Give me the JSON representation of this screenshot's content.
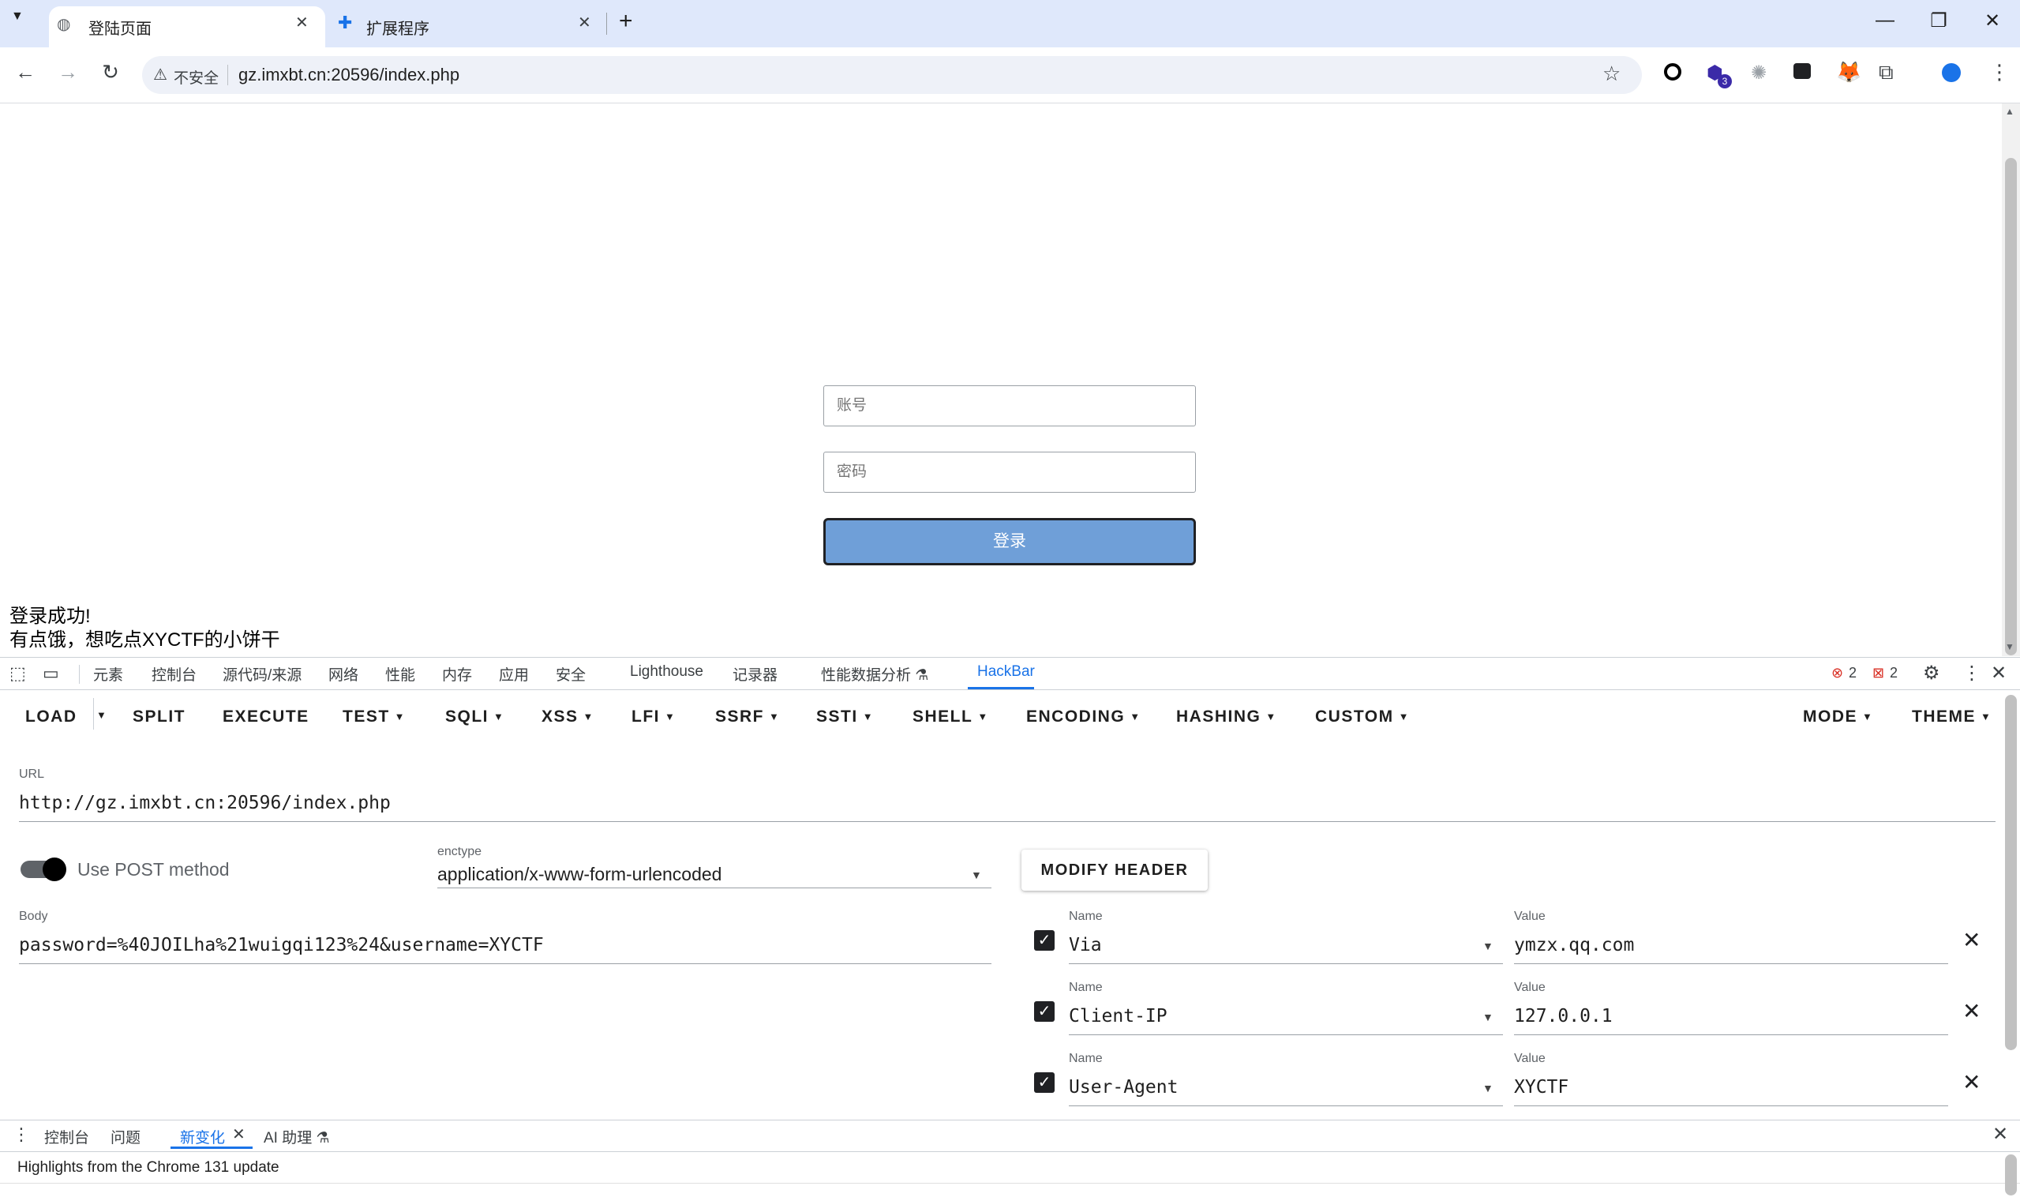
{
  "browser": {
    "tabs": [
      {
        "title": "登陆页面",
        "active": true
      },
      {
        "title": "扩展程序",
        "active": false
      }
    ],
    "new_tab": "+",
    "window_controls": {
      "minimize": "—",
      "restore": "❐",
      "close": "✕"
    },
    "url_security": "不安全",
    "url": "gz.imxbt.cn:20596/index.php",
    "extension_badge": "3"
  },
  "page": {
    "username_placeholder": "账号",
    "password_placeholder": "密码",
    "login_label": "登录",
    "result_line1": "登录成功!",
    "result_line2": "有点饿，想吃点XYCTF的小饼干"
  },
  "devtools": {
    "tabs": [
      "元素",
      "控制台",
      "源代码/来源",
      "网络",
      "性能",
      "内存",
      "应用",
      "安全",
      "Lighthouse",
      "记录器",
      "性能数据分析 ⚗",
      "HackBar"
    ],
    "active_tab": "HackBar",
    "error_count": "2",
    "warning_count": "2",
    "drawer_tabs": [
      "控制台",
      "问题",
      "新变化",
      "AI 助理 ⚗"
    ],
    "drawer_active": "新变化",
    "drawer_message": "Highlights from the Chrome 131 update"
  },
  "hackbar": {
    "menu": [
      "LOAD",
      "SPLIT",
      "EXECUTE",
      "TEST",
      "SQLI",
      "XSS",
      "LFI",
      "SSRF",
      "SSTI",
      "SHELL",
      "ENCODING",
      "HASHING",
      "CUSTOM"
    ],
    "right_menu": [
      "MODE",
      "THEME"
    ],
    "url_label": "URL",
    "url_value": "http://gz.imxbt.cn:20596/index.php",
    "post_label": "Use POST method",
    "post_enabled": true,
    "enctype_label": "enctype",
    "enctype_value": "application/x-www-form-urlencoded",
    "body_label": "Body",
    "body_value": "password=%40JOILha%21wuigqi123%24&username=XYCTF",
    "modify_header_label": "MODIFY HEADER",
    "name_label": "Name",
    "value_label": "Value",
    "headers": [
      {
        "name": "Via",
        "value": "ymzx.qq.com",
        "enabled": true
      },
      {
        "name": "Client-IP",
        "value": "127.0.0.1",
        "enabled": true
      },
      {
        "name": "User-Agent",
        "value": "XYCTF",
        "enabled": true
      }
    ]
  },
  "colors": {
    "tabstrip": "#dfe8fb",
    "login_button": "#6f9fd8",
    "devtools_active": "#1a73e8"
  }
}
